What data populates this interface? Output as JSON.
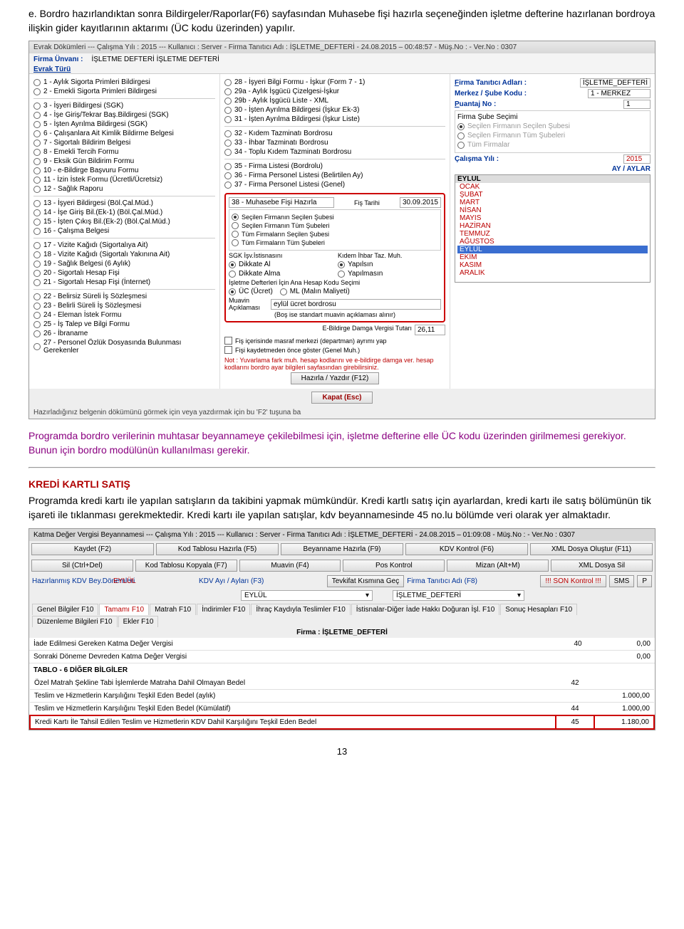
{
  "intro": "e. Bordro hazırlandıktan sonra Bildirgeler/Raporlar(F6) sayfasından Muhasebe fişi hazırla seçeneğinden işletme defterine hazırlanan bordroya ilişkin gider kayıtlarının aktarımı (ÜC kodu üzerinden) yapılır.",
  "app1": {
    "title": "Evrak Dökümleri  ---  Çalışma Yılı : 2015  ---  Kullanıcı : Server - Firma Tanıtıcı Adı : İŞLETME_DEFTERİ - 24.08.2015 – 00:48:57 - Müş.No :  - Ver.No : 0307",
    "firma_unvani_label": "Firma Ünvanı :",
    "firma_unvani_val": "İŞLETME DEFTERİ İŞLETME DEFTERİ",
    "evrak_turu": "Evrak Türü",
    "col1": [
      "1 - Aylık Sigorta Primleri Bildirgesi",
      "2 - Emekli Sigorta Primleri Bildirgesi",
      "3 - İşyeri Bildirgesi (SGK)",
      "4 - İşe Giriş/Tekrar Baş.Bildirgesi (SGK)",
      "5 - İşten Ayrılma Bildirgesi (SGK)",
      "6 - Çalışanlara Ait Kimlik Bildirme Belgesi",
      "7 - Sigortalı Bildirim Belgesi",
      "8 - Emekli Tercih Formu",
      "9 - Eksik Gün Bildirim Formu",
      "10 - e-Bildirge Başvuru Formu",
      "11 - İzin İstek Formu (Ücretli/Ücretsiz)",
      "12 - Sağlık Raporu",
      "13 - İşyeri Bildirgesi (Böl.Çal.Müd.)",
      "14 - İşe Giriş Bil.(Ek-1) (Böl.Çal.Müd.)",
      "15 - İşten Çıkış Bil.(Ek-2) (Böl.Çal.Müd.)",
      "16 - Çalışma Belgesi",
      "17 - Vizite Kağıdı (Sigortalıya Ait)",
      "18 - Vizite Kağıdı (Sigortalı Yakınına Ait)",
      "19 - Sağlık Belgesi  (6 Aylık)",
      "20 - Sigortalı Hesap Fişi",
      "21 - Sigortalı Hesap Fişi (İnternet)",
      "22 - Belirsiz Süreli İş Sözleşmesi",
      "23 - Belirli Süreli İş Sözleşmesi",
      "24 - Eleman İstek Formu",
      "25 - İş Talep ve Bilgi Formu",
      "26 - İbraname",
      "27 - Personel Özlük Dosyasında Bulunması Gerekenler"
    ],
    "col2_top": [
      "28 - İşyeri Bilgi Formu - İşkur (Form 7 - 1)",
      "29a - Aylık İşgücü Çizelgesi-İşkur",
      "29b - Aylık İşgücü Liste - XML",
      "30 - İşten Ayrılma Bildirgesi (İşkur Ek-3)",
      "31 - İşten Ayrılma Bildirgesi (İşkur Liste)",
      "32 - Kıdem Tazminatı Bordrosu",
      "33 - İhbar Tazminatı Bordrosu",
      "34 - Toplu Kıdem Tazminatı Bordrosu",
      "35 - Firma Listesi (Bordrolu)",
      "36 - Firma Personel Listesi (Belirtilen Ay)",
      "37 - Firma Personel Listesi (Genel)"
    ],
    "redbox": {
      "opt": "38 - Muhasebe Fişi Hazırla",
      "fis_tarihi_label": "Fiş Tarihi",
      "fis_tarihi": "30.09.2015",
      "sel": [
        "Seçilen Firmanın Seçilen Şubesi",
        "Seçilen Firmanın Tüm Şubeleri",
        "Tüm Firmaların Seçilen Şubesi",
        "Tüm Firmaların Tüm Şubeleri"
      ],
      "sgk": "SGK İşv.İstisnasını",
      "dikkat": [
        "Dikkate Al",
        "Dikkate Alma"
      ],
      "kidem": "Kıdem İhbar Taz. Muh.",
      "yap": [
        "Yapılsın",
        "Yapılmasın"
      ],
      "hesap": "İşletme Defterleri İçin Ana Hesap Kodu Seçimi",
      "uc": "ÜC (Ücret)",
      "ml": "ML (Malın Maliyeti)",
      "muavin_label": "Muavin Açıklaması",
      "muavin": "eylül ücret bordrosu",
      "bos": "(Boş ise standart muavin açıklaması alınır)"
    },
    "ebil_label": "E-Bildirge Damga Vergisi Tutarı",
    "ebil_val": "26,11",
    "chk1": "Fiş içerisinde masraf merkezi (departman) ayrımı yap",
    "chk2": "Fişi kaydetmeden önce göster (Genel Muh.)",
    "note": "Not : Yuvarlama fark muh. hesap kodlarını ve e-bildirge damga ver. hesap kodlarını bordro ayar bilgileri sayfasından girebilirsiniz.",
    "btn_haz": "Hazırla / Yazdır (F12)",
    "btn_kapat": "Kapat (Esc)",
    "footer": "Hazırladığınız belgenin dökümünü görmek için veya yazdırmak için bu 'F2' tuşuna ba",
    "right": {
      "fta_label": "Firma Tanıtıcı Adları :",
      "fta_val": "İŞLETME_DEFTERİ",
      "msk_label": "Merkez / Şube Kodu :",
      "msk_val": "1 - MERKEZ",
      "pn_label": "Puantaj No :",
      "pn_val": "1",
      "sube_title": "Firma Şube Seçimi",
      "sube_opts": [
        "Seçilen Firmanın Seçilen Şubesi",
        "Seçilen Firmanın Tüm Şubeleri",
        "Tüm Firmalar"
      ],
      "cy_label": "Çalışma Yılı :",
      "cy_val": "2015",
      "ay_label": "AY / AYLAR",
      "month_hdr": "EYLÜL",
      "months": [
        "OCAK",
        "ŞUBAT",
        "MART",
        "NİSAN",
        "MAYIS",
        "HAZİRAN",
        "TEMMUZ",
        "AĞUSTOS",
        "EYLÜL",
        "EKİM",
        "KASIM",
        "ARALIK"
      ]
    }
  },
  "purple": "Programda bordro verilerinin muhtasar beyannameye çekilebilmesi için, işletme defterine elle ÜC kodu üzerinden girilmemesi gerekiyor. Bunun için bordro modülünün kullanılması gerekir.",
  "h2": "KREDİ KARTLI SATIŞ",
  "body": "Programda kredi kartı ile yapılan satışların da takibini yapmak mümkündür. Kredi kartlı satış için ayarlardan, kredi kartı ile satış bölümünün tik işareti ile tıklanması gerekmektedir. Kredi kartı ile yapılan satışlar, kdv beyannamesinde 45 no.lu bölümde veri olarak yer almaktadır.",
  "app2": {
    "title": "Katma Değer Vergisi Beyannamesi  ---  Çalışma Yılı : 2015  ---  Kullanıcı : Server - Firma Tanıtıcı Adı : İŞLETME_DEFTERİ - 24.08.2015 – 01:09:08 - Müş.No :  - Ver.No : 0307",
    "toolbar1": [
      "Kaydet (F2)",
      "Kod Tablosu Hazırla (F5)",
      "Beyanname Hazırla (F9)",
      "KDV Kontrol (F6)",
      "XML Dosya Oluştur (F11)"
    ],
    "toolbar2": [
      "Sil (Ctrl+Del)",
      "Kod Tablosu Kopyala (F7)",
      "Muavin (F4)",
      "Pos Kontrol",
      "Mizan (Alt+M)",
      "XML Dosya Sil"
    ],
    "row3": {
      "hkb": "Hazırlanmış KDV Bey.Dönemleri",
      "hkb_val": "EYLÜL",
      "kdvay_label": "KDV Ayı / Ayları (F3)",
      "kdvay_val": "EYLÜL",
      "tevkifat": "Tevkifat Kısmına Geç",
      "fta_label": "Firma Tanıtıcı Adı (F8)",
      "fta_val": "İŞLETME_DEFTERİ",
      "son": "!!! SON Kontrol !!!",
      "sms": "SMS",
      "p": "P"
    },
    "tabs": [
      "Genel Bilgiler F10",
      "Tamamı F10",
      "Matrah F10",
      "İndirimler F10",
      "İhraç Kaydıyla Teslimler F10",
      "İstisnalar-Diğer İade Hakkı Doğuran İşl. F10",
      "Sonuç Hesapları F10",
      "Düzenleme Bilgileri F10",
      "Ekler F10"
    ],
    "firma": "Firma : İŞLETME_DEFTERİ",
    "rows": [
      {
        "label": "İade Edilmesi Gereken Katma Değer Vergisi",
        "code": "40",
        "val": "0,00"
      },
      {
        "label": "Sonraki Döneme Devreden Katma Değer Vergisi",
        "code": "",
        "val": "0,00"
      }
    ],
    "tablo6": "TABLO - 6   DİĞER BİLGİLER",
    "rows2": [
      {
        "label": "Özel Matrah Şekline Tabi İşlemlerde Matraha Dahil Olmayan Bedel",
        "code": "42",
        "val": ""
      },
      {
        "label": "Teslim ve Hizmetlerin Karşılığını  Teşkil Eden Bedel (aylık)",
        "code": "",
        "val": "1.000,00"
      },
      {
        "label": "Teslim ve Hizmetlerin Karşılığını  Teşkil Eden Bedel (Kümülatif)",
        "code": "44",
        "val": "1.000,00"
      }
    ],
    "redrow": {
      "label": "Kredi Kartı İle Tahsil Edilen Teslim ve Hizmetlerin KDV Dahil Karşılığını Teşkil Eden Bedel",
      "code": "45",
      "val": "1.180,00"
    }
  },
  "page_num": "13"
}
